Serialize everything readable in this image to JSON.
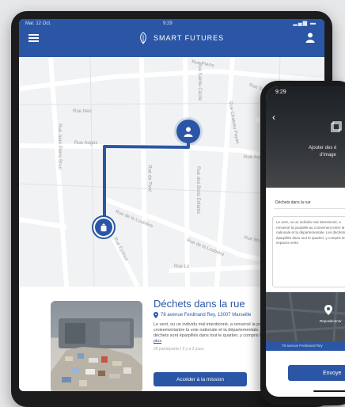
{
  "colors": {
    "accent": "#2b56a5",
    "background": "#e6e7e9"
  },
  "tablet": {
    "status": {
      "date": "Mar. 12 Oct.",
      "time": "9:29",
      "signal": "▂▄▆ ▬"
    },
    "header": {
      "brand_title": "SMART FUTURES",
      "menu_icon": "hamburger-icon",
      "profile_icon": "user-icon"
    },
    "map": {
      "streets": [
        "Rue Pierre",
        "Rue Saint-P",
        "Rue Neu",
        "Rue Augus",
        "Rue Jean Pierre Brun",
        "Rue Chateau Payan",
        "Rue Augu",
        "Rue des Bons Enfants",
        "Rue de Tivol",
        "Rue de la Loubière",
        "Rue Eydoux",
        "Rue de la Loubière",
        "Rue Lo",
        "Rue Brue",
        "Rue Sainte-Cécile"
      ]
    },
    "mission": {
      "title": "Déchets dans la rue",
      "address": "78 avenue Ferdinand Rey, 13007 Marseille",
      "description": "Le vent, ou un individu mal intentionné, a renversé la poubelle au croisementantre la voie nationale et la départementale. Les déchets sont éparpillés dans tout le quartier, y compris les...",
      "more_link": "voir plus",
      "meta": "28 participants  |  Il y a 2 jours",
      "cta": "Accéder à la mission"
    }
  },
  "phone": {
    "time": "9:29",
    "back_icon": "chevron-left-icon",
    "add_photo_text_1": "Ajouter des é",
    "add_photo_text_2": "d'image",
    "field_title": "Déchets dans la rue",
    "description": "Le vent, ou un individu mal intentionné, a renversé la poubelle au croisement entre la voie nationale et la départementale. Les déchets sont éparpillés dans tout le quartier, y compris les espaces verts.",
    "location_label": "Repositionner",
    "address": "78 avenue Ferdinand Rey",
    "send_label": "Envoye"
  }
}
